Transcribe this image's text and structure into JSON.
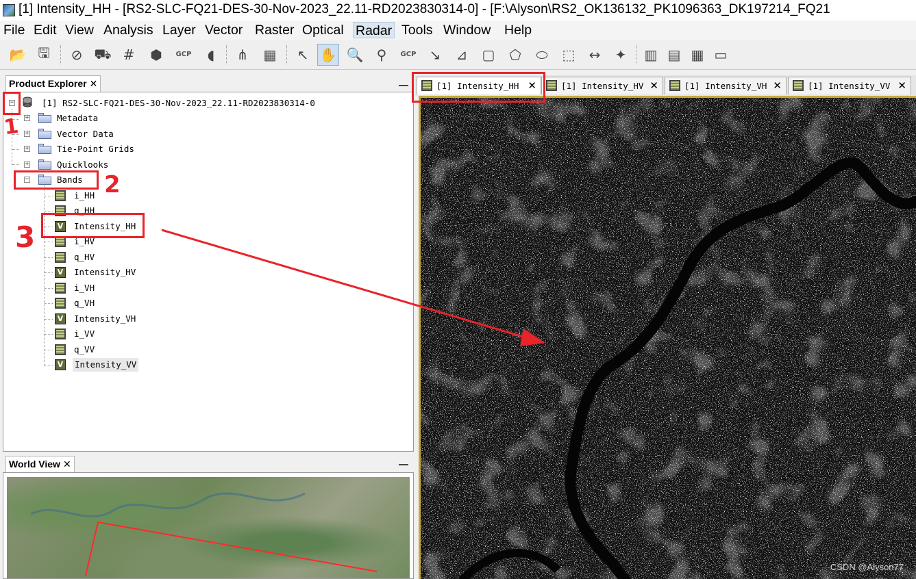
{
  "window": {
    "title": "[1] Intensity_HH - [RS2-SLC-FQ21-DES-30-Nov-2023_22.11-RD2023830314-0] - [F:\\Alyson\\RS2_OK136132_PK1096363_DK197214_FQ21"
  },
  "menu": [
    {
      "label": "File",
      "name": "file"
    },
    {
      "label": "Edit",
      "name": "edit"
    },
    {
      "label": "View",
      "name": "view"
    },
    {
      "label": "Analysis",
      "name": "analysis"
    },
    {
      "label": "Layer",
      "name": "layer"
    },
    {
      "label": "Vector",
      "name": "vector"
    },
    {
      "label": "Raster",
      "name": "raster"
    },
    {
      "label": "Optical",
      "name": "optical"
    },
    {
      "label": "Radar",
      "name": "radar"
    },
    {
      "label": "Tools",
      "name": "tools"
    },
    {
      "label": "Window",
      "name": "window"
    },
    {
      "label": "Help",
      "name": "help"
    }
  ],
  "menu_active": "radar",
  "toolbar": {
    "gcp_label": "GCP",
    "icons": [
      "open-product-icon",
      "save-product-icon",
      "no-data-overlay-icon",
      "mask-tool-icon",
      "graticule-icon",
      "pin-placemark-icon",
      "gcp-placemark-icon",
      "world-map-icon",
      "product-library-icon",
      "pixel-info-icon",
      "select-tool-icon",
      "pan-tool-icon",
      "zoom-tool-icon",
      "pin-tool-icon",
      "gcp-tool-icon",
      "line-tool-icon",
      "polyline-tool-icon",
      "rectangle-tool-icon",
      "polygon-tool-icon",
      "ellipse-tool-icon",
      "range-finder-icon",
      "magic-wand-icon",
      "tile-evenly-icon",
      "tile-horizontal-icon",
      "tile-vertical-icon",
      "tile-single-icon"
    ],
    "pressed": "pan-tool-icon"
  },
  "product_explorer": {
    "title": "Product Explorer",
    "product": "[1] RS2-SLC-FQ21-DES-30-Nov-2023_22.11-RD2023830314-0",
    "folders": [
      "Metadata",
      "Vector Data",
      "Tie-Point Grids",
      "Quicklooks",
      "Bands"
    ],
    "bands": [
      {
        "label": "i_HH",
        "virtual": false
      },
      {
        "label": "q_HH",
        "virtual": false
      },
      {
        "label": "Intensity_HH",
        "virtual": true
      },
      {
        "label": "i_HV",
        "virtual": false
      },
      {
        "label": "q_HV",
        "virtual": false
      },
      {
        "label": "Intensity_HV",
        "virtual": true
      },
      {
        "label": "i_VH",
        "virtual": false
      },
      {
        "label": "q_VH",
        "virtual": false
      },
      {
        "label": "Intensity_VH",
        "virtual": true
      },
      {
        "label": "i_VV",
        "virtual": false
      },
      {
        "label": "q_VV",
        "virtual": false
      },
      {
        "label": "Intensity_VV",
        "virtual": true
      }
    ],
    "virtual_badge": "V",
    "selected_band": "Intensity_VV"
  },
  "world_view": {
    "title": "World View"
  },
  "document_tabs": [
    {
      "label": "[1] Intensity_HH",
      "active": true
    },
    {
      "label": "[1] Intensity_HV",
      "active": false
    },
    {
      "label": "[1] Intensity_VH",
      "active": false
    },
    {
      "label": "[1] Intensity_VV",
      "active": false
    }
  ],
  "annotations": {
    "step1": "1",
    "step2": "2",
    "step3": "3",
    "color": "#e8232a"
  },
  "watermark": "CSDN @Alyson77"
}
